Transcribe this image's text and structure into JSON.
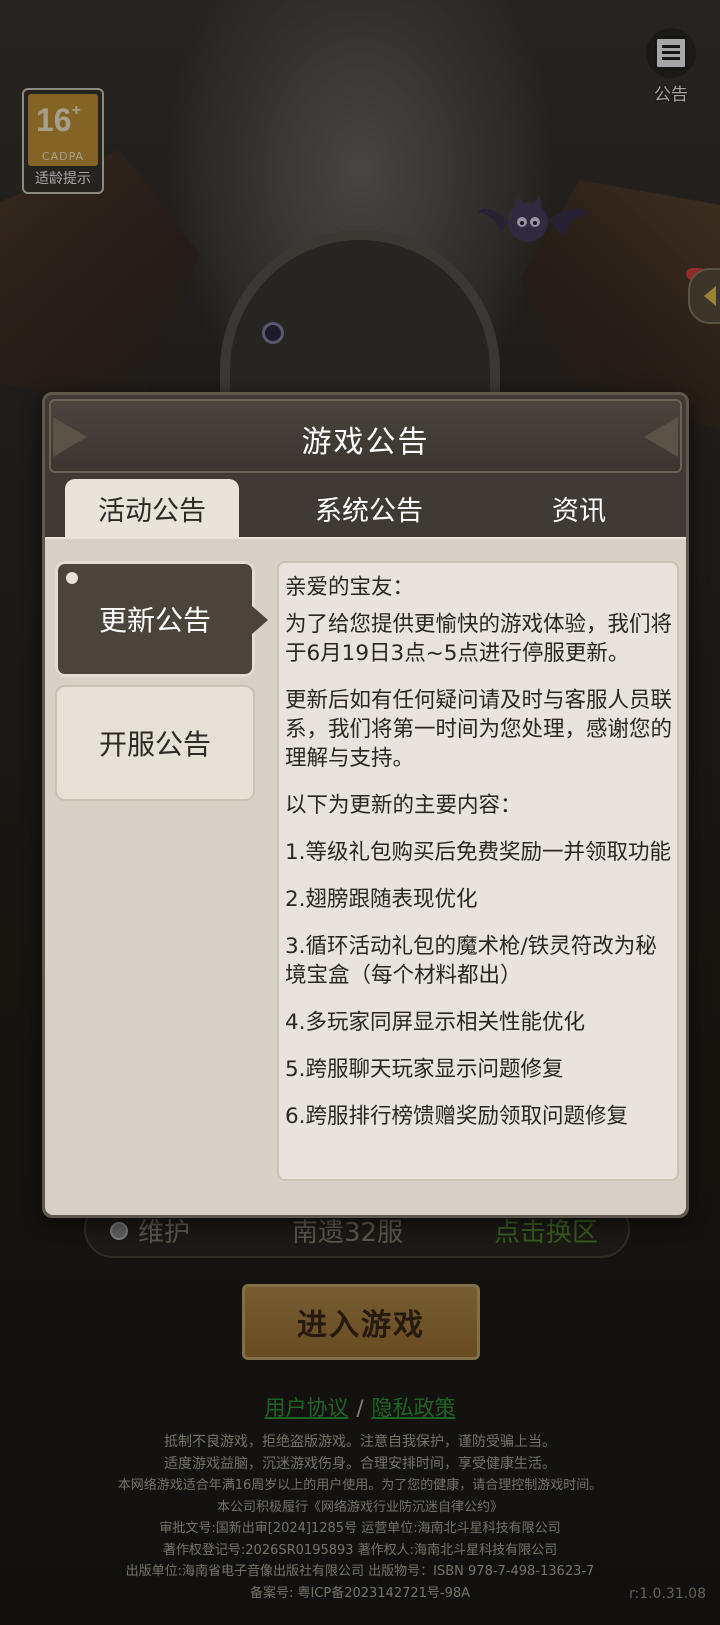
{
  "age_rating": {
    "age": "16",
    "plus": "+",
    "org": "CADPA",
    "label": "适龄提示"
  },
  "notice_button": {
    "label": "公告",
    "icon": "notice-icon"
  },
  "server": {
    "status": "维护",
    "name": "南遗32服",
    "switch_label": "点击换区"
  },
  "enter_button": {
    "label": "进入游戏"
  },
  "links": {
    "user_agreement": "用户协议",
    "separator": "/",
    "privacy_policy": "隐私政策"
  },
  "footer": [
    "抵制不良游戏，拒绝盗版游戏。注意自我保护，谨防受骗上当。",
    "适度游戏益脑，沉迷游戏伤身。合理安排时间，享受健康生活。",
    "本网络游戏适合年满16周岁以上的用户使用。为了您的健康，请合理控制游戏时间。",
    "本公司积极履行《网络游戏行业防沉迷自律公约》",
    "审批文号:国新出审[2024]1285号 运营单位:海南北斗星科技有限公司",
    "著作权登记号:2026SR0195893 著作权人:海南北斗星科技有限公司",
    "出版单位:海南省电子音像出版社有限公司 出版物号：ISBN 978-7-498-13623-7",
    "备案号: 粤ICP备2023142721号-98A"
  ],
  "version": "r:1.0.31.08",
  "modal": {
    "title": "游戏公告",
    "tabs": [
      "活动公告",
      "系统公告",
      "资讯"
    ],
    "active_tab": "活动公告",
    "sub_tabs": [
      "更新公告",
      "开服公告"
    ],
    "active_sub_tab": "更新公告",
    "content": {
      "greeting": "亲爱的宝友：",
      "p1": "为了给您提供更愉快的游戏体验，我们将于6月19日3点~5点进行停服更新。",
      "p2": "更新后如有任何疑问请及时与客服人员联系，我们将第一时间为您处理，感谢您的理解与支持。",
      "p3": "以下为更新的主要内容：",
      "items": [
        "1.等级礼包购买后免费奖励一并领取功能",
        "2.翅膀跟随表现优化",
        "3.循环活动礼包的魔术枪/铁灵符改为秘境宝盒（每个材料都出）",
        "4.多玩家同屏显示相关性能优化",
        "5.跨服聊天玩家显示问题修复",
        "6.跨服排行榜馈赠奖励领取问题修复"
      ]
    }
  }
}
